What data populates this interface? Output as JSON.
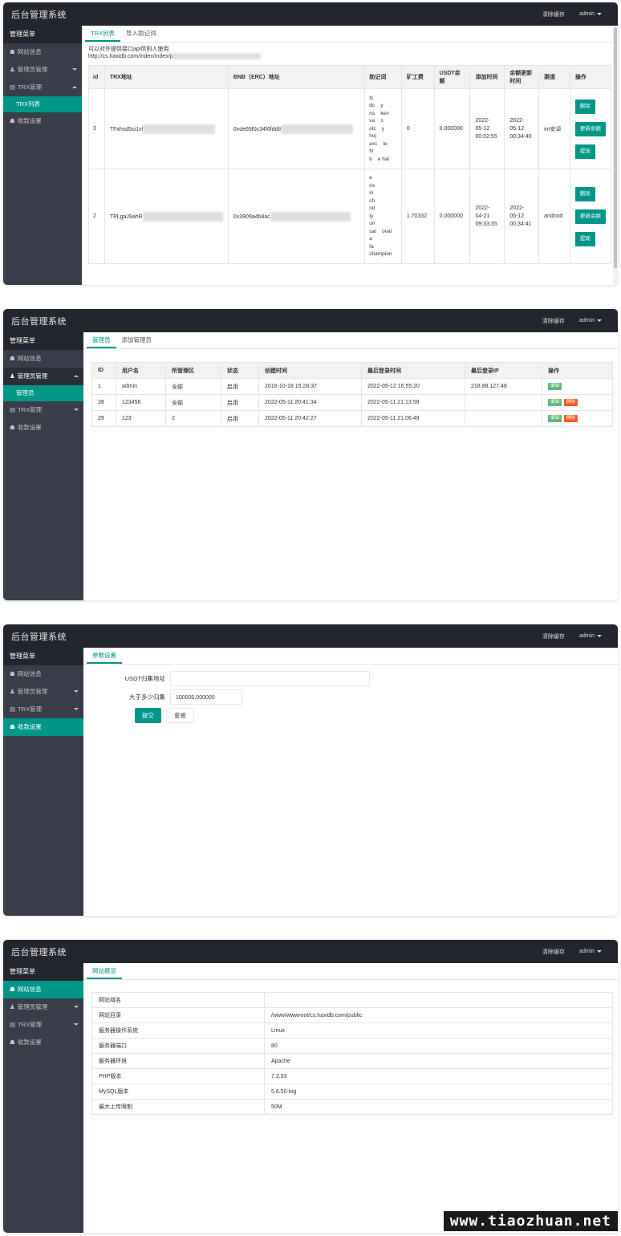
{
  "app_title": "后台管理系统",
  "clear_cache": "清除缓存",
  "user": "admin",
  "sidebar": {
    "header": "管理菜单",
    "site_info": "网站信息",
    "admin_mgmt": "管理员管理",
    "admin_sub": "管理员",
    "trx_mgmt": "TRX管理",
    "trx_sub": "TRX列表",
    "payment": "收款设置"
  },
  "panel1": {
    "tabs": [
      "TRX列表",
      "导入助记词"
    ],
    "note_line1": "可以对外提供接口api供别人使用",
    "note_line2": "http://cs.haxidb.com/index/index/p",
    "columns": [
      "id",
      "TRX地址",
      "BNB（ERC）地址",
      "助记词",
      "矿工费",
      "USDT余额",
      "添加时间",
      "余额更新时间",
      "渠道",
      "操作"
    ],
    "rows": [
      {
        "id": "3",
        "trx": "TFxhsd5si1vf",
        "bnb": "0xde65f0c34f6fdd8",
        "mnemonic": "fc\ndc    y\nris    ken\nva    s\nolc    y\nhoj\nexc    le\nfir\nti    e hat",
        "fee": "0",
        "usdt": "0.000000",
        "added": "2022-\n05-12\n00:02:55",
        "updated": "2022-\n05-12\n00:34:40",
        "channel": "im安卓"
      },
      {
        "id": "2",
        "trx": "TPLgaJ9ahR",
        "bnb": "0x3909a4b8ac",
        "mnemonic": "e\nrix\nin\nch\nnd\nty\non\nual    oval\na\nfa\nchampion",
        "fee": "1.70332",
        "usdt": "0.000000",
        "added": "2022-\n04-21\n09:33:35",
        "updated": "2022-\n05-12\n00:34:41",
        "channel": "android"
      }
    ],
    "actions": [
      "删除",
      "更新余额",
      "提现"
    ]
  },
  "panel2": {
    "tabs": [
      "管理员",
      "添加管理员"
    ],
    "columns": [
      "ID",
      "用户名",
      "所管理区",
      "状态",
      "创建时间",
      "最后登录时间",
      "最后登录IP",
      "操作"
    ],
    "rows": [
      {
        "id": "1",
        "user": "admin",
        "area": "全部",
        "status": "启用",
        "created": "2016-10-18 15:28:37",
        "last": "2022-05-12 16:55:20",
        "ip": "218.88.127.48",
        "del": false
      },
      {
        "id": "28",
        "user": "123456",
        "area": "全部",
        "status": "启用",
        "created": "2022-05-11 20:41:34",
        "last": "2022-05-11 21:13:59",
        "ip": "",
        "del": true
      },
      {
        "id": "29",
        "user": "123",
        "area": "2",
        "status": "启用",
        "created": "2022-05-11 20:42:27",
        "last": "2022-05-11 21:06:49",
        "ip": "",
        "del": true
      }
    ],
    "edit": "编辑",
    "delete": "删除"
  },
  "panel3": {
    "tab": "参数设置",
    "usdt_label": "USDT归集地址",
    "usdt_value": "",
    "threshold_label": "大于多少归集",
    "threshold_value": "100000.000000",
    "submit": "提交",
    "reset": "重置"
  },
  "panel4": {
    "tab": "网站概览",
    "rows": [
      {
        "k": "网站域名",
        "v": ""
      },
      {
        "k": "网站目录",
        "v": "/www/wwwroot/cs.haxidb.com/public"
      },
      {
        "k": "服务器操作系统",
        "v": "Linux"
      },
      {
        "k": "服务器端口",
        "v": "80"
      },
      {
        "k": "服务器环境",
        "v": "Apache"
      },
      {
        "k": "PHP版本",
        "v": "7.2.33"
      },
      {
        "k": "MySQL版本",
        "v": "5.6.50-log"
      },
      {
        "k": "最大上传限制",
        "v": "50M"
      }
    ]
  },
  "watermark": "www.tiaozhuan.net"
}
